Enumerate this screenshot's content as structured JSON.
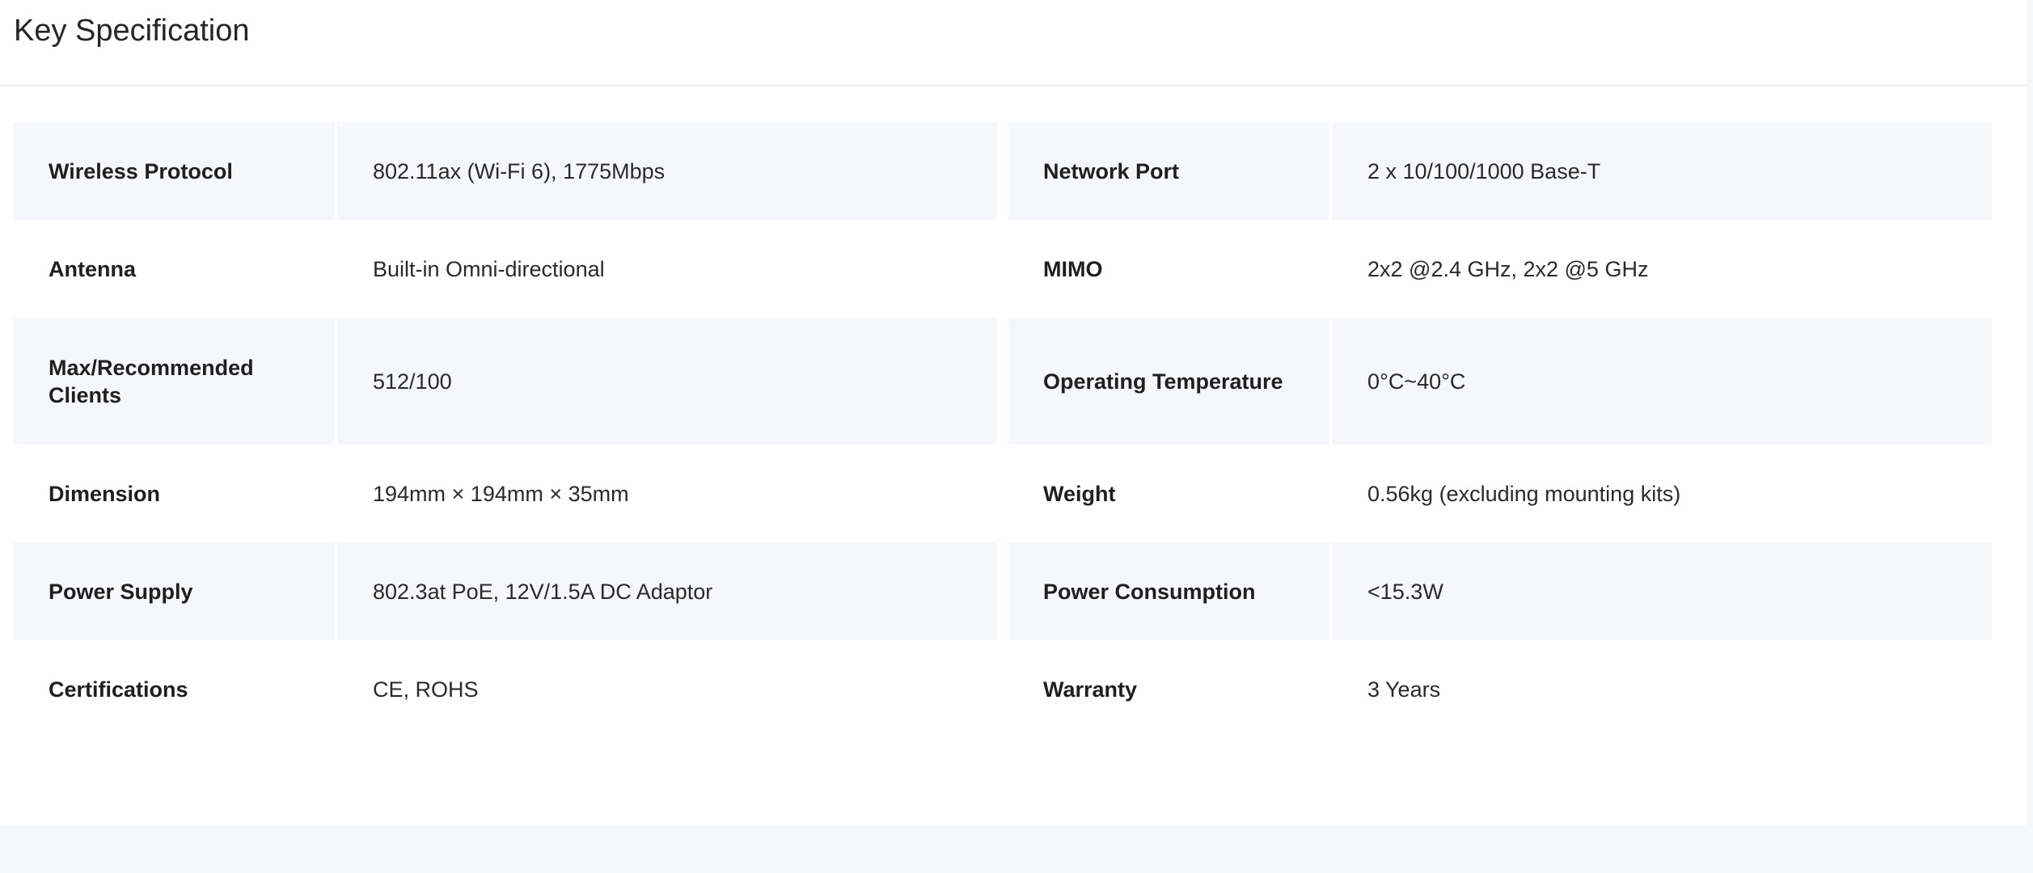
{
  "page": {
    "title": "Key Specification"
  },
  "specs": [
    {
      "left": {
        "label": "Wireless Protocol",
        "value": "802.11ax (Wi-Fi 6), 1775Mbps"
      },
      "right": {
        "label": "Network Port",
        "value": "2 x 10/100/1000 Base-T"
      }
    },
    {
      "left": {
        "label": "Antenna",
        "value": "Built-in Omni-directional"
      },
      "right": {
        "label": "MIMO",
        "value": "2x2 @2.4 GHz, 2x2 @5 GHz"
      }
    },
    {
      "left": {
        "label": "Max/Recommended Clients",
        "value": "512/100"
      },
      "right": {
        "label": "Operating Temperature",
        "value": "0°C~40°C"
      }
    },
    {
      "left": {
        "label": "Dimension",
        "value": "194mm × 194mm × 35mm"
      },
      "right": {
        "label": "Weight",
        "value": "0.56kg (excluding mounting kits)"
      }
    },
    {
      "left": {
        "label": "Power Supply",
        "value": "802.3at PoE, 12V/1.5A DC Adaptor"
      },
      "right": {
        "label": "Power Consumption",
        "value": "<15.3W"
      }
    },
    {
      "left": {
        "label": "Certifications",
        "value": "CE, ROHS"
      },
      "right": {
        "label": "Warranty",
        "value": "3 Years"
      }
    }
  ],
  "colors": {
    "page_background": "#f6f7fa",
    "panel_background": "#ffffff",
    "row_shade": "#f6f7fa",
    "divider": "#e3e5ea",
    "text": "#232323"
  }
}
